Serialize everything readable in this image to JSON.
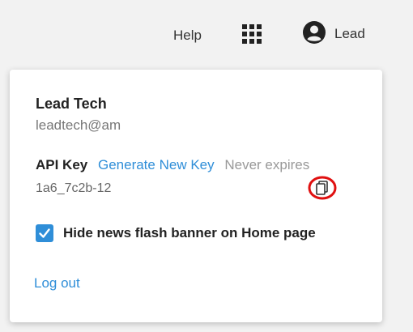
{
  "header": {
    "help_label": "Help",
    "apps_icon": "grid-icon",
    "user_icon": "account-circle-icon",
    "user_label": "Lead"
  },
  "account_menu": {
    "name": "Lead Tech",
    "email": "leadtech@am",
    "api_key_label": "API Key",
    "generate_key_label": "Generate New Key",
    "expiry_text": "Never expires",
    "api_key_value": "1a6_7c2b-12",
    "copy_icon": "copy-icon",
    "hide_banner_label": "Hide news flash banner on Home page",
    "hide_banner_checked": true,
    "logout_label": "Log out"
  },
  "colors": {
    "link": "#2f8ed8",
    "checkbox": "#2f8ed8",
    "highlight_circle": "#e01010"
  }
}
